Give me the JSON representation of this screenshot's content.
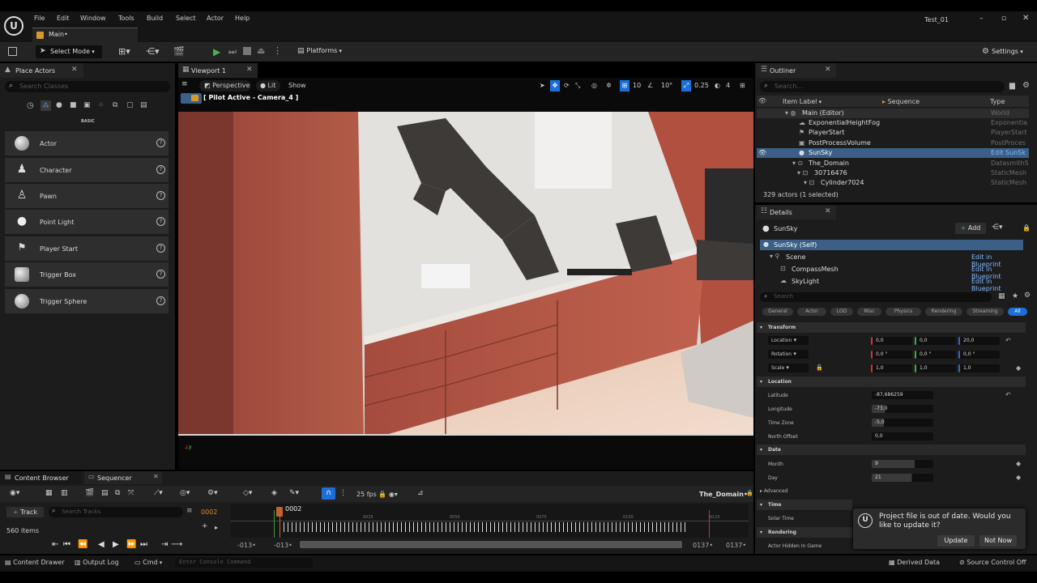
{
  "menu": {
    "items": [
      "File",
      "Edit",
      "Window",
      "Tools",
      "Build",
      "Select",
      "Actor",
      "Help"
    ],
    "project": "Test_01"
  },
  "main_tab": "Main•",
  "toolbar": {
    "select_mode": "Select Mode",
    "platforms": "Platforms",
    "settings": "Settings"
  },
  "place_actors": {
    "tab": "Place Actors",
    "search_placeholder": "Search Classes",
    "category": "BASIC",
    "items": [
      "Actor",
      "Character",
      "Pawn",
      "Point Light",
      "Player Start",
      "Trigger Box",
      "Trigger Sphere"
    ]
  },
  "viewport": {
    "tab": "Viewport 1",
    "perspective": "Perspective",
    "lit": "Lit",
    "show": "Show",
    "pilot": "[ Pilot Active - Camera_4 ]",
    "grid": "10",
    "angle": "10°",
    "scale": "0.25",
    "cams": "4"
  },
  "outliner": {
    "tab": "Outliner",
    "search_placeholder": "Search...",
    "headers": {
      "label": "Item Label",
      "sequence": "Sequence",
      "type": "Type"
    },
    "rows": [
      {
        "label": "Main (Editor)",
        "type": "World"
      },
      {
        "label": "ExponentialHeightFog",
        "type": "Exponentia"
      },
      {
        "label": "PlayerStart",
        "type": "PlayerStart"
      },
      {
        "label": "PostProcessVolume",
        "type": "PostProces"
      },
      {
        "label": "SunSky",
        "type": "Edit SunSk"
      },
      {
        "label": "The_Domain",
        "type": "DatasmithS"
      },
      {
        "label": "30716476",
        "type": "StaticMesh"
      },
      {
        "label": "Cylinder7024",
        "type": "StaticMesh"
      }
    ],
    "count": "329 actors (1 selected)"
  },
  "details": {
    "tab": "Details",
    "actor": "SunSky",
    "add": "Add",
    "components": [
      {
        "label": "SunSky (Self)",
        "action": ""
      },
      {
        "label": "Scene",
        "action": "Edit in Blueprint"
      },
      {
        "label": "CompassMesh",
        "action": "Edit in Blueprint"
      },
      {
        "label": "SkyLight",
        "action": "Edit in Blueprint"
      }
    ],
    "search_placeholder": "Search",
    "categories": [
      "General",
      "Actor",
      "LOD",
      "Misc",
      "Physics",
      "Rendering",
      "Streaming",
      "All"
    ],
    "transform": {
      "title": "Transform",
      "location": {
        "label": "Location",
        "x": "0,0",
        "y": "0,0",
        "z": "20,0"
      },
      "rotation": {
        "label": "Rotation",
        "x": "0,0 °",
        "y": "0,0 °",
        "z": "0,0 °"
      },
      "scale": {
        "label": "Scale",
        "x": "1,0",
        "y": "1,0",
        "z": "1,0"
      }
    },
    "location_section": {
      "title": "Location",
      "latitude": {
        "label": "Latitude",
        "value": "-87,686259"
      },
      "longitude": {
        "label": "Longitude",
        "value": "-73,0"
      },
      "timezone": {
        "label": "Time Zone",
        "value": "-5,0"
      },
      "north": {
        "label": "North Offset",
        "value": "0,0"
      }
    },
    "date_section": {
      "title": "Date",
      "month": {
        "label": "Month",
        "value": "9"
      },
      "day": {
        "label": "Day",
        "value": "21"
      }
    },
    "advanced": "Advanced",
    "time_section": {
      "title": "Time",
      "solar": "Solar Time"
    },
    "rendering_section": {
      "title": "Rendering",
      "hidden": "Actor Hidden In Game"
    }
  },
  "bottom_tabs": {
    "content_browser": "Content Browser",
    "sequencer": "Sequencer"
  },
  "sequencer": {
    "fps": "25 fps",
    "sequence_name": "The_Domain•",
    "track": "Track",
    "search_placeholder": "Search Tracks",
    "frame": "0002",
    "playhead": "0002",
    "items_count": "560 items",
    "ticks": [
      "0025",
      "0050",
      "0075",
      "0100",
      "0125"
    ],
    "range_start": "-013•",
    "range_start2": "-013•",
    "range_end": "0137•",
    "range_end2": "0137•"
  },
  "notification": {
    "text": "Project file is out of date. Would you like to update it?",
    "update": "Update",
    "not_now": "Not Now"
  },
  "status": {
    "content_drawer": "Content Drawer",
    "output_log": "Output Log",
    "cmd": "Cmd",
    "console_placeholder": "Enter Console Command",
    "derived": "Derived Data",
    "source_control": "Source Control Off"
  },
  "colors": {
    "accent": "#1c6fd6",
    "play": "#4caf50",
    "select": "#3b5f86"
  }
}
